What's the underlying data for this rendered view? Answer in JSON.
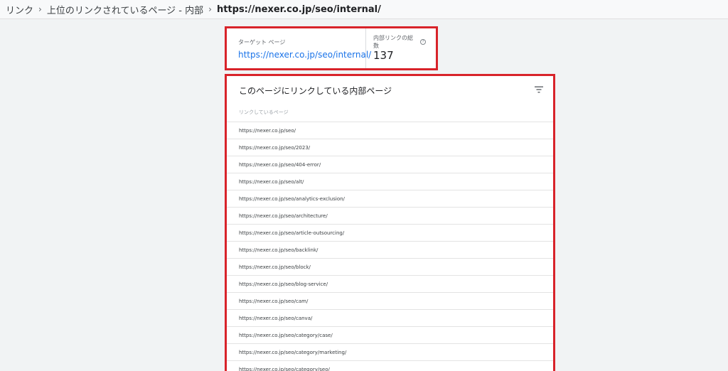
{
  "breadcrumb": {
    "items": [
      "リンク",
      "上位のリンクされているページ - 内部"
    ],
    "current": "https://nexer.co.jp/seo/internal/"
  },
  "summary": {
    "target_label": "ターゲット ページ",
    "target_url": "https://nexer.co.jp/seo/internal/",
    "count_label": "内部リンクの総数",
    "count_value": "137"
  },
  "panel": {
    "title": "このページにリンクしている内部ページ",
    "column_header": "リンクしているページ",
    "rows": [
      "https://nexer.co.jp/seo/",
      "https://nexer.co.jp/seo/2023/",
      "https://nexer.co.jp/seo/404-error/",
      "https://nexer.co.jp/seo/alt/",
      "https://nexer.co.jp/seo/analytics-exclusion/",
      "https://nexer.co.jp/seo/architecture/",
      "https://nexer.co.jp/seo/article-outsourcing/",
      "https://nexer.co.jp/seo/backlink/",
      "https://nexer.co.jp/seo/block/",
      "https://nexer.co.jp/seo/blog-service/",
      "https://nexer.co.jp/seo/cam/",
      "https://nexer.co.jp/seo/canva/",
      "https://nexer.co.jp/seo/category/case/",
      "https://nexer.co.jp/seo/category/marketing/",
      "https://nexer.co.jp/seo/category/seo/"
    ]
  },
  "colors": {
    "highlight": "#d8232a",
    "link": "#1a73e8"
  }
}
